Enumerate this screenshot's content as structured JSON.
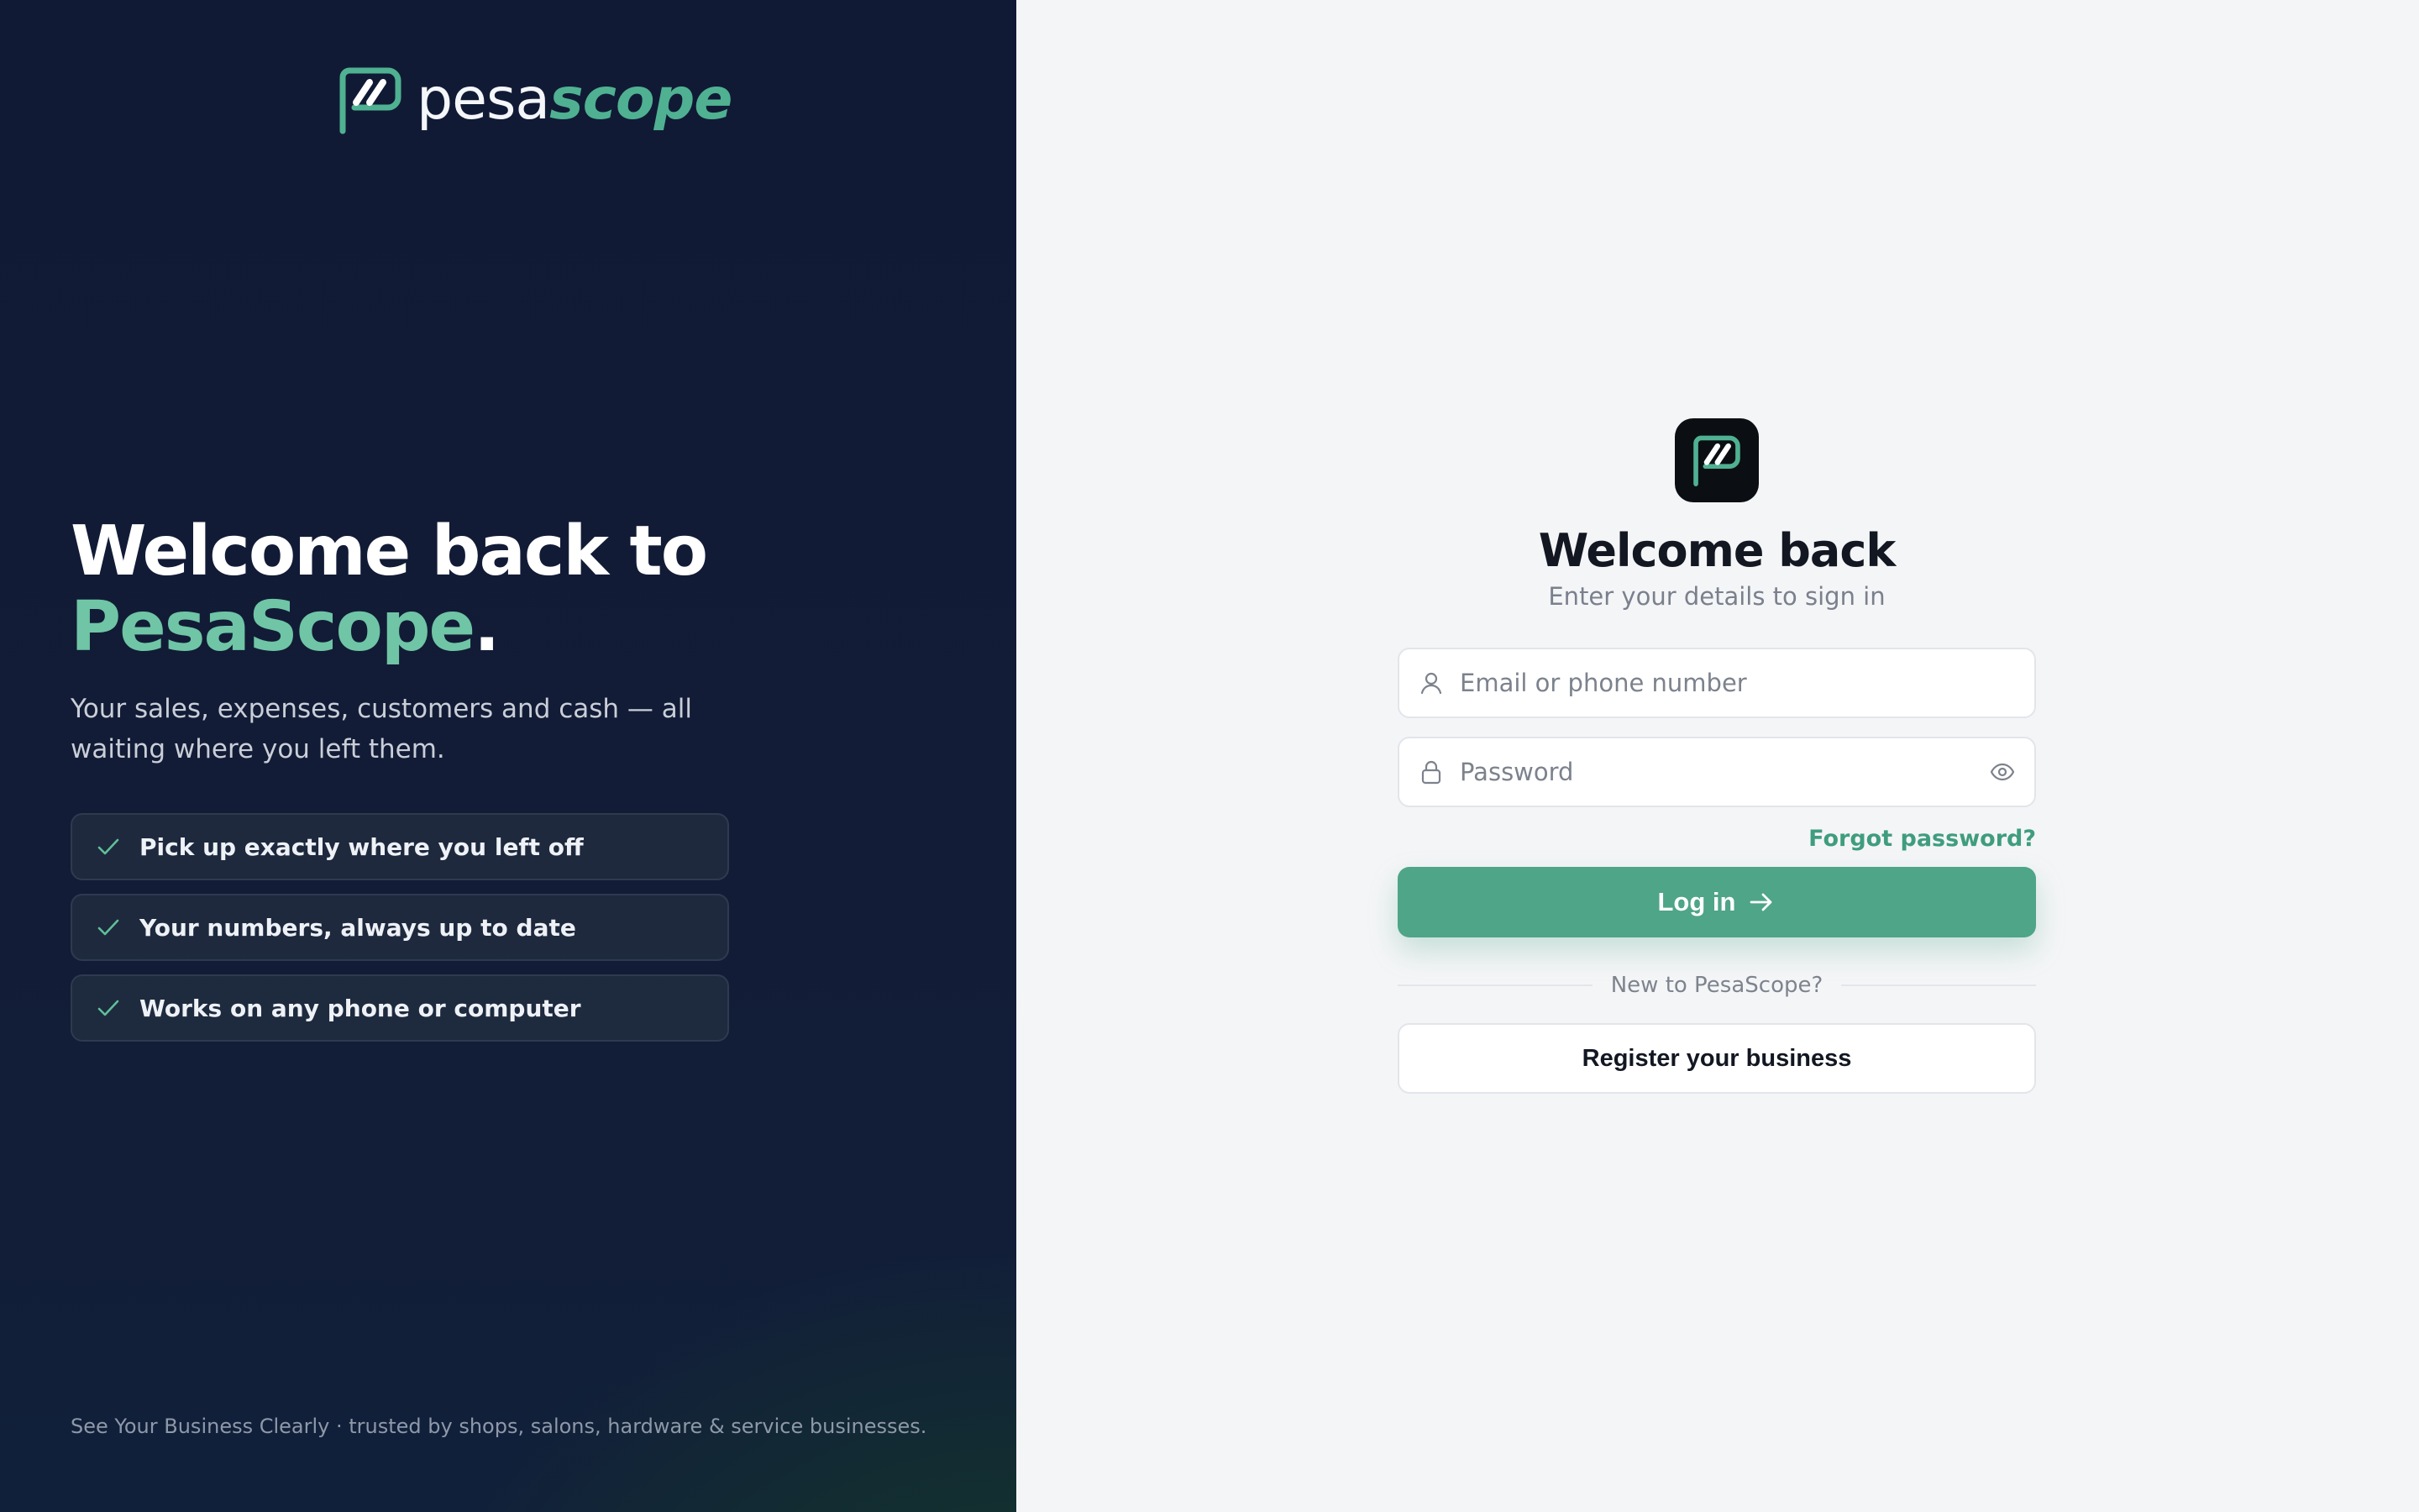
{
  "brand": {
    "name_part1": "pesa",
    "name_part2": "scope",
    "icon": "pesascope-logo-icon"
  },
  "hero": {
    "heading_line1": "Welcome back to",
    "heading_accent": "PesaScope",
    "heading_period": ".",
    "subtext": "Your sales, expenses, customers and cash — all waiting where you left them.",
    "features": [
      {
        "label": "Pick up exactly where you left off",
        "icon": "check-icon"
      },
      {
        "label": "Your numbers, always up to date",
        "icon": "check-icon"
      },
      {
        "label": "Works on any phone or computer",
        "icon": "check-icon"
      }
    ]
  },
  "footer_note": "See Your Business Clearly · trusted by shops, salons, hardware & service businesses.",
  "login": {
    "title": "Welcome back",
    "subtitle": "Enter your details to sign in",
    "email_placeholder": "Email or phone number",
    "email_value": "",
    "password_placeholder": "Password",
    "password_value": "",
    "forgot_label": "Forgot password?",
    "login_label": "Log in",
    "divider_label": "New to PesaScope?",
    "register_label": "Register your business"
  },
  "colors": {
    "accent": "#4ea587",
    "accent_text": "#3f9d7d",
    "left_bg": "#111a35",
    "right_bg": "#f4f5f7"
  }
}
